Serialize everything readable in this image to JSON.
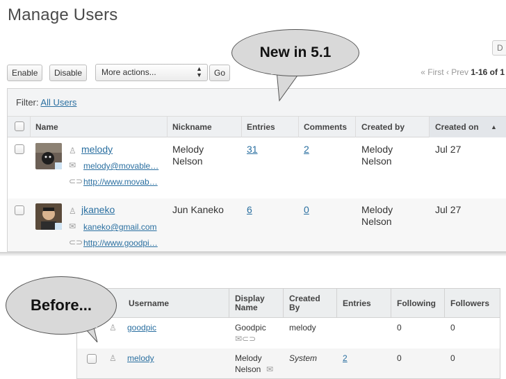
{
  "page": {
    "title": "Manage Users",
    "top_right_label": "D"
  },
  "toolbar": {
    "enable_label": "Enable",
    "disable_label": "Disable",
    "more_actions_value": "More actions...",
    "go_label": "Go"
  },
  "pager": {
    "first": "« First",
    "prev": "‹ Prev",
    "range": "1-16 of 1"
  },
  "filter": {
    "label": "Filter:",
    "value": "All Users"
  },
  "table": {
    "columns": [
      "Name",
      "Nickname",
      "Entries",
      "Comments",
      "Created by",
      "Created on"
    ],
    "sort_indicator": "▲",
    "rows": [
      {
        "username": "melody",
        "email": "melody@movable…",
        "url": "http://www.movab…",
        "nickname_line1": "Melody",
        "nickname_line2": "Nelson",
        "entries": "31",
        "comments": "2",
        "created_by_line1": "Melody",
        "created_by_line2": "Nelson",
        "created_on": "Jul 27"
      },
      {
        "username": "jkaneko",
        "email": "kaneko@gmail.com",
        "url": "http://www.goodpi…",
        "nickname_line1": "Jun Kaneko",
        "nickname_line2": "",
        "entries": "6",
        "comments": "0",
        "created_by_line1": "Melody",
        "created_by_line2": "Nelson",
        "created_on": "Jul 27"
      }
    ]
  },
  "callouts": {
    "new_label": "New in 5.1",
    "before_label": "Before..."
  },
  "old_table": {
    "columns": {
      "username": "Username",
      "display_line1": "Display",
      "display_line2": "Name",
      "created_line1": "Created",
      "created_line2": "By",
      "entries": "Entries",
      "following": "Following",
      "followers": "Followers"
    },
    "rows": [
      {
        "username": "goodpic",
        "display_line1": "Goodpic",
        "created_by": "melody",
        "entries": "",
        "following": "0",
        "followers": "0"
      },
      {
        "username": "melody",
        "display_line1": "Melody",
        "display_line2": "Nelson",
        "created_by": "System",
        "entries": "2",
        "following": "0",
        "followers": "0"
      }
    ]
  },
  "colors": {
    "link": "#2a6fa0",
    "header_bg": "#eef0f2",
    "bubble_fill": "#d9d9d9"
  },
  "icons": [
    "user-icon",
    "envelope-icon",
    "link-icon",
    "sort-ascending-icon",
    "select-arrows-icon"
  ]
}
